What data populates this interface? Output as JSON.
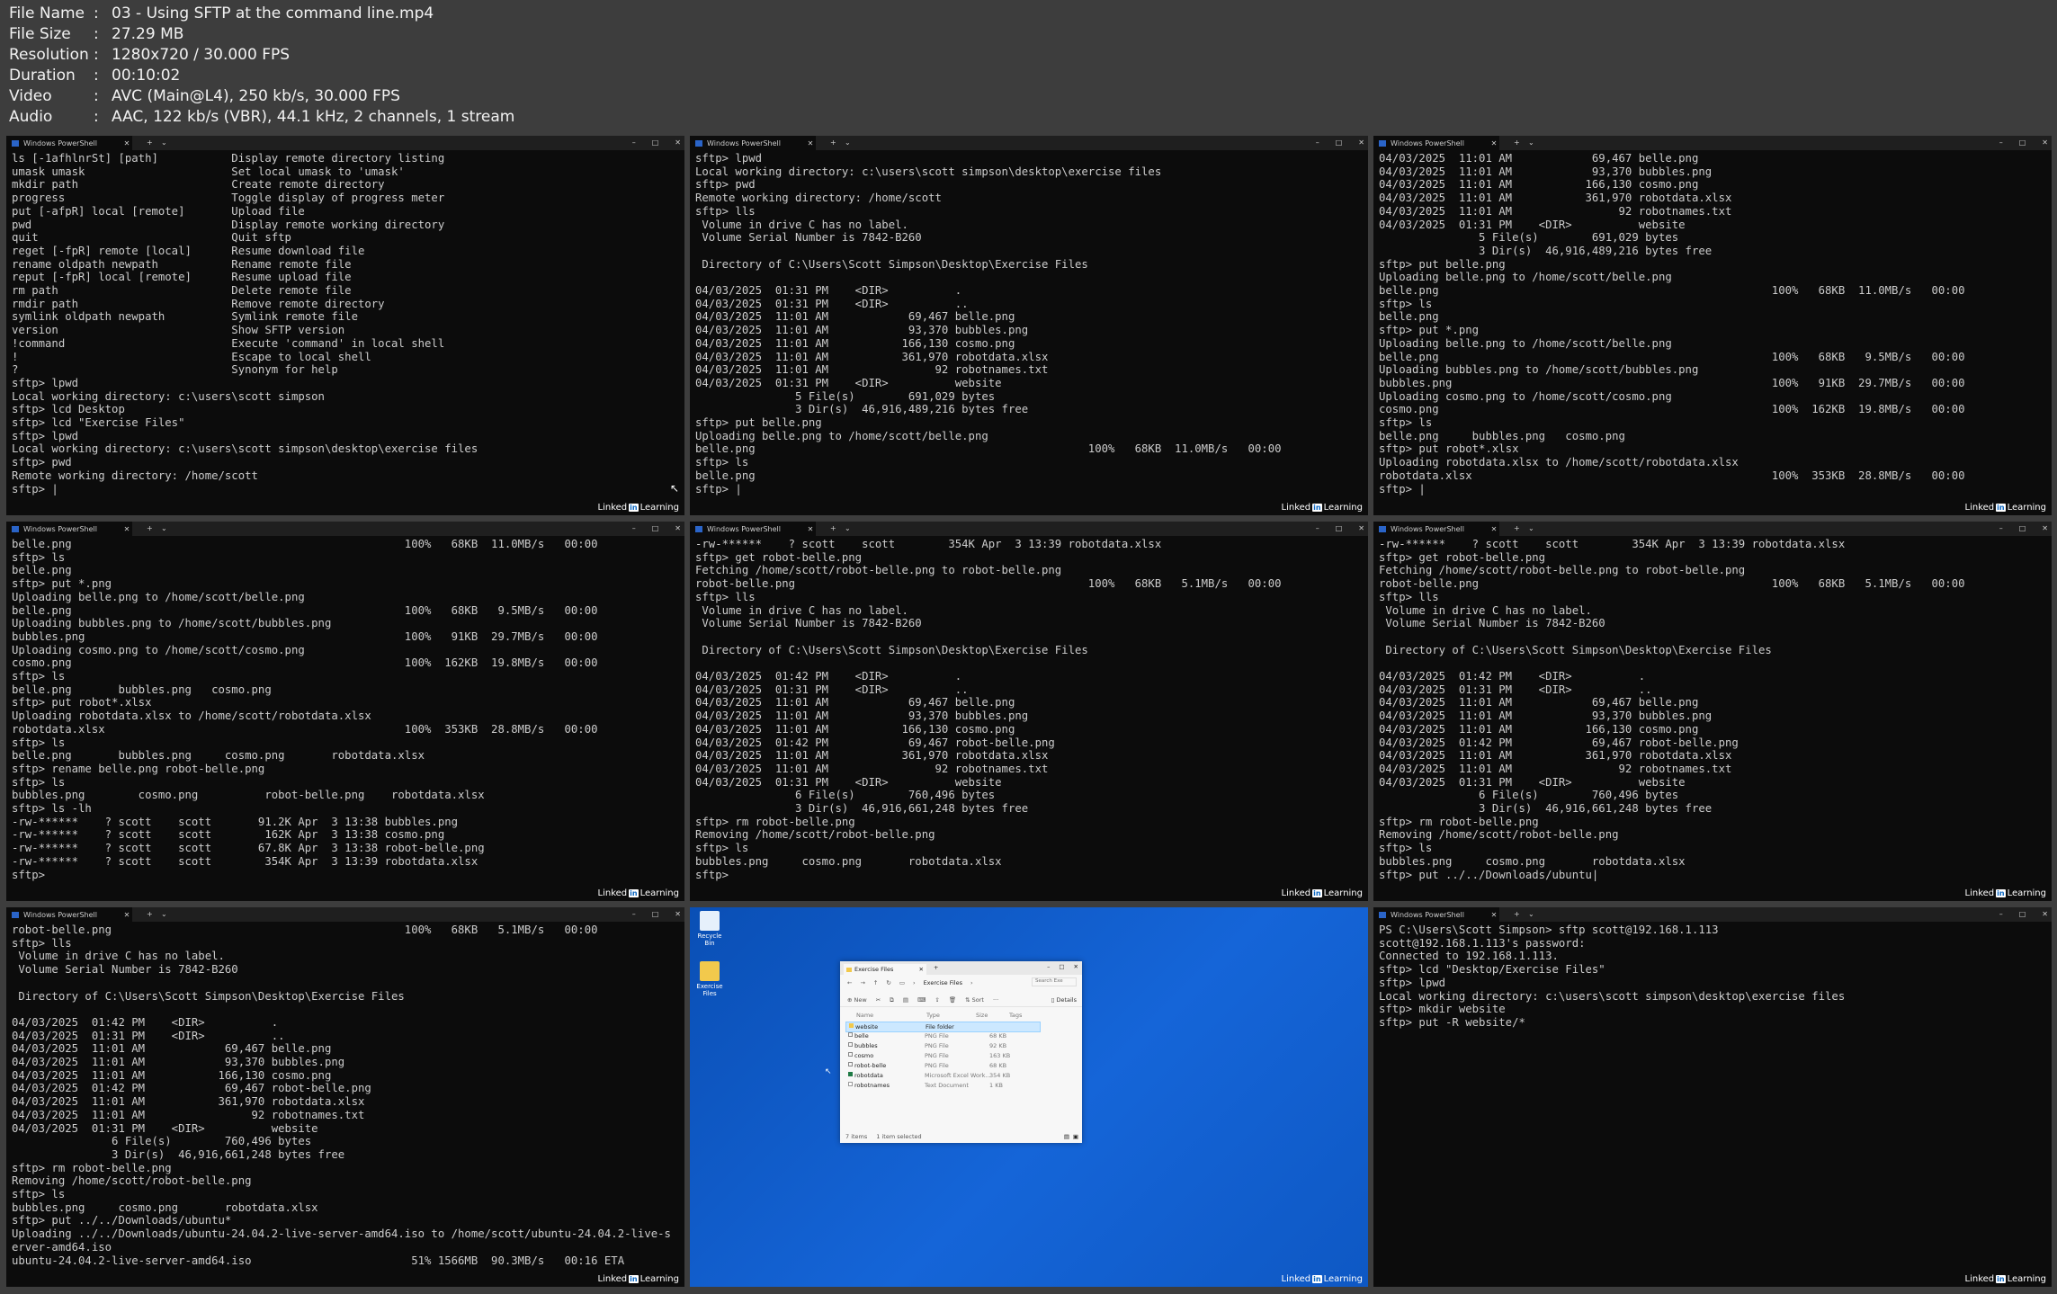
{
  "header": {
    "rows": [
      {
        "key": "File Name",
        "value": "03 - Using SFTP at the command line.mp4"
      },
      {
        "key": "File Size",
        "value": "27.29 MB"
      },
      {
        "key": "Resolution",
        "value": "1280x720 / 30.000 FPS"
      },
      {
        "key": "Duration",
        "value": "00:10:02"
      },
      {
        "key": "Video",
        "value": "AVC (Main@L4), 250 kb/s, 30.000 FPS"
      },
      {
        "key": "Audio",
        "value": "AAC, 122 kb/s (VBR), 44.1 kHz, 2 channels, 1 stream"
      }
    ]
  },
  "watermark": {
    "badge": "in",
    "pre": "Linked",
    "post": "Learning"
  },
  "tab_title": "Windows PowerShell",
  "glyphs": {
    "close": "✕",
    "plus": "+",
    "chevron": "⌄",
    "minimize": "–",
    "maximize": "□"
  },
  "desktop": {
    "recycle_label": "Recycle Bin",
    "folder_label": "Exercise Files",
    "explorer": {
      "tab": "Exercise Files",
      "crumb": "Exercise Files",
      "search": "Search Exe",
      "new": "New",
      "sort": "Sort",
      "details": "Details",
      "cols": {
        "name": "Name",
        "type": "Type",
        "size": "Size",
        "tags": "Tags"
      },
      "rows": [
        {
          "name": "website",
          "type": "File folder",
          "size": ""
        },
        {
          "name": "belle",
          "type": "PNG File",
          "size": "68 KB"
        },
        {
          "name": "bubbles",
          "type": "PNG File",
          "size": "92 KB"
        },
        {
          "name": "cosmo",
          "type": "PNG File",
          "size": "163 KB"
        },
        {
          "name": "robot-belle",
          "type": "PNG File",
          "size": "68 KB"
        },
        {
          "name": "robotdata",
          "type": "Microsoft Excel Work...",
          "size": "354 KB"
        },
        {
          "name": "robotnames",
          "type": "Text Document",
          "size": "1 KB"
        }
      ],
      "status_items": "7 items",
      "status_selected": "1 item selected"
    }
  },
  "terminals": {
    "t1": "ls [-1afhlnrSt] [path]           Display remote directory listing\numask umask                      Set local umask to 'umask'\nmkdir path                       Create remote directory\nprogress                         Toggle display of progress meter\nput [-afpR] local [remote]       Upload file\npwd                              Display remote working directory\nquit                             Quit sftp\nreget [-fpR] remote [local]      Resume download file\nrename oldpath newpath           Rename remote file\nreput [-fpR] local [remote]      Resume upload file\nrm path                          Delete remote file\nrmdir path                       Remove remote directory\nsymlink oldpath newpath          Symlink remote file\nversion                          Show SFTP version\n!command                         Execute 'command' in local shell\n!                                Escape to local shell\n?                                Synonym for help\nsftp> lpwd\nLocal working directory: c:\\users\\scott simpson\nsftp> lcd Desktop\nsftp> lcd \"Exercise Files\"\nsftp> lpwd\nLocal working directory: c:\\users\\scott simpson\\desktop\\exercise files\nsftp> pwd\nRemote working directory: /home/scott\nsftp> |",
    "t2": "sftp> lpwd\nLocal working directory: c:\\users\\scott simpson\\desktop\\exercise files\nsftp> pwd\nRemote working directory: /home/scott\nsftp> lls\n Volume in drive C has no label.\n Volume Serial Number is 7842-B260\n\n Directory of C:\\Users\\Scott Simpson\\Desktop\\Exercise Files\n\n04/03/2025  01:31 PM    <DIR>          .\n04/03/2025  01:31 PM    <DIR>          ..\n04/03/2025  11:01 AM            69,467 belle.png\n04/03/2025  11:01 AM            93,370 bubbles.png\n04/03/2025  11:01 AM           166,130 cosmo.png\n04/03/2025  11:01 AM           361,970 robotdata.xlsx\n04/03/2025  11:01 AM                92 robotnames.txt\n04/03/2025  01:31 PM    <DIR>          website\n               5 File(s)        691,029 bytes\n               3 Dir(s)  46,916,489,216 bytes free\nsftp> put belle.png\nUploading belle.png to /home/scott/belle.png\nbelle.png                                                  100%   68KB  11.0MB/s   00:00\nsftp> ls\nbelle.png\nsftp> |",
    "t3": "04/03/2025  11:01 AM            69,467 belle.png\n04/03/2025  11:01 AM            93,370 bubbles.png\n04/03/2025  11:01 AM           166,130 cosmo.png\n04/03/2025  11:01 AM           361,970 robotdata.xlsx\n04/03/2025  11:01 AM                92 robotnames.txt\n04/03/2025  01:31 PM    <DIR>          website\n               5 File(s)        691,029 bytes\n               3 Dir(s)  46,916,489,216 bytes free\nsftp> put belle.png\nUploading belle.png to /home/scott/belle.png\nbelle.png                                                  100%   68KB  11.0MB/s   00:00\nsftp> ls\nbelle.png\nsftp> put *.png\nUploading belle.png to /home/scott/belle.png\nbelle.png                                                  100%   68KB   9.5MB/s   00:00\nUploading bubbles.png to /home/scott/bubbles.png\nbubbles.png                                                100%   91KB  29.7MB/s   00:00\nUploading cosmo.png to /home/scott/cosmo.png\ncosmo.png                                                  100%  162KB  19.8MB/s   00:00\nsftp> ls\nbelle.png     bubbles.png   cosmo.png\nsftp> put robot*.xlsx\nUploading robotdata.xlsx to /home/scott/robotdata.xlsx\nrobotdata.xlsx                                             100%  353KB  28.8MB/s   00:00\nsftp> |",
    "t4": "belle.png                                                  100%   68KB  11.0MB/s   00:00\nsftp> ls\nbelle.png\nsftp> put *.png\nUploading belle.png to /home/scott/belle.png\nbelle.png                                                  100%   68KB   9.5MB/s   00:00\nUploading bubbles.png to /home/scott/bubbles.png\nbubbles.png                                                100%   91KB  29.7MB/s   00:00\nUploading cosmo.png to /home/scott/cosmo.png\ncosmo.png                                                  100%  162KB  19.8MB/s   00:00\nsftp> ls\nbelle.png       bubbles.png   cosmo.png\nsftp> put robot*.xlsx\nUploading robotdata.xlsx to /home/scott/robotdata.xlsx\nrobotdata.xlsx                                             100%  353KB  28.8MB/s   00:00\nsftp> ls\nbelle.png       bubbles.png     cosmo.png       robotdata.xlsx\nsftp> rename belle.png robot-belle.png\nsftp> ls\nbubbles.png        cosmo.png          robot-belle.png    robotdata.xlsx\nsftp> ls -lh\n-rw-******    ? scott    scott       91.2K Apr  3 13:38 bubbles.png\n-rw-******    ? scott    scott        162K Apr  3 13:38 cosmo.png\n-rw-******    ? scott    scott       67.8K Apr  3 13:38 robot-belle.png\n-rw-******    ? scott    scott        354K Apr  3 13:39 robotdata.xlsx\nsftp>",
    "t5": "-rw-******    ? scott    scott        354K Apr  3 13:39 robotdata.xlsx\nsftp> get robot-belle.png\nFetching /home/scott/robot-belle.png to robot-belle.png\nrobot-belle.png                                            100%   68KB   5.1MB/s   00:00\nsftp> lls\n Volume in drive C has no label.\n Volume Serial Number is 7842-B260\n\n Directory of C:\\Users\\Scott Simpson\\Desktop\\Exercise Files\n\n04/03/2025  01:42 PM    <DIR>          .\n04/03/2025  01:31 PM    <DIR>          ..\n04/03/2025  11:01 AM            69,467 belle.png\n04/03/2025  11:01 AM            93,370 bubbles.png\n04/03/2025  11:01 AM           166,130 cosmo.png\n04/03/2025  01:42 PM            69,467 robot-belle.png\n04/03/2025  11:01 AM           361,970 robotdata.xlsx\n04/03/2025  11:01 AM                92 robotnames.txt\n04/03/2025  01:31 PM    <DIR>          website\n               6 File(s)        760,496 bytes\n               3 Dir(s)  46,916,661,248 bytes free\nsftp> rm robot-belle.png\nRemoving /home/scott/robot-belle.png\nsftp> ls\nbubbles.png     cosmo.png       robotdata.xlsx\nsftp>",
    "t6": "-rw-******    ? scott    scott        354K Apr  3 13:39 robotdata.xlsx\nsftp> get robot-belle.png\nFetching /home/scott/robot-belle.png to robot-belle.png\nrobot-belle.png                                            100%   68KB   5.1MB/s   00:00\nsftp> lls\n Volume in drive C has no label.\n Volume Serial Number is 7842-B260\n\n Directory of C:\\Users\\Scott Simpson\\Desktop\\Exercise Files\n\n04/03/2025  01:42 PM    <DIR>          .\n04/03/2025  01:31 PM    <DIR>          ..\n04/03/2025  11:01 AM            69,467 belle.png\n04/03/2025  11:01 AM            93,370 bubbles.png\n04/03/2025  11:01 AM           166,130 cosmo.png\n04/03/2025  01:42 PM            69,467 robot-belle.png\n04/03/2025  11:01 AM           361,970 robotdata.xlsx\n04/03/2025  11:01 AM                92 robotnames.txt\n04/03/2025  01:31 PM    <DIR>          website\n               6 File(s)        760,496 bytes\n               3 Dir(s)  46,916,661,248 bytes free\nsftp> rm robot-belle.png\nRemoving /home/scott/robot-belle.png\nsftp> ls\nbubbles.png     cosmo.png       robotdata.xlsx\nsftp> put ../../Downloads/ubuntu|",
    "t7": "robot-belle.png                                            100%   68KB   5.1MB/s   00:00\nsftp> lls\n Volume in drive C has no label.\n Volume Serial Number is 7842-B260\n\n Directory of C:\\Users\\Scott Simpson\\Desktop\\Exercise Files\n\n04/03/2025  01:42 PM    <DIR>          .\n04/03/2025  01:31 PM    <DIR>          ..\n04/03/2025  11:01 AM            69,467 belle.png\n04/03/2025  11:01 AM            93,370 bubbles.png\n04/03/2025  11:01 AM           166,130 cosmo.png\n04/03/2025  01:42 PM            69,467 robot-belle.png\n04/03/2025  11:01 AM           361,970 robotdata.xlsx\n04/03/2025  11:01 AM                92 robotnames.txt\n04/03/2025  01:31 PM    <DIR>          website\n               6 File(s)        760,496 bytes\n               3 Dir(s)  46,916,661,248 bytes free\nsftp> rm robot-belle.png\nRemoving /home/scott/robot-belle.png\nsftp> ls\nbubbles.png     cosmo.png       robotdata.xlsx\nsftp> put ../../Downloads/ubuntu*\nUploading ../../Downloads/ubuntu-24.04.2-live-server-amd64.iso to /home/scott/ubuntu-24.04.2-live-s\nerver-amd64.iso\nubuntu-24.04.2-live-server-amd64.iso                        51% 1566MB  90.3MB/s   00:16 ETA",
    "t9": "PS C:\\Users\\Scott Simpson> sftp scott@192.168.1.113\nscott@192.168.1.113's password:\nConnected to 192.168.1.113.\nsftp> lcd \"Desktop/Exercise Files\"\nsftp> lpwd\nLocal working directory: c:\\users\\scott simpson\\desktop\\exercise files\nsftp> mkdir website\nsftp> put -R website/*"
  }
}
